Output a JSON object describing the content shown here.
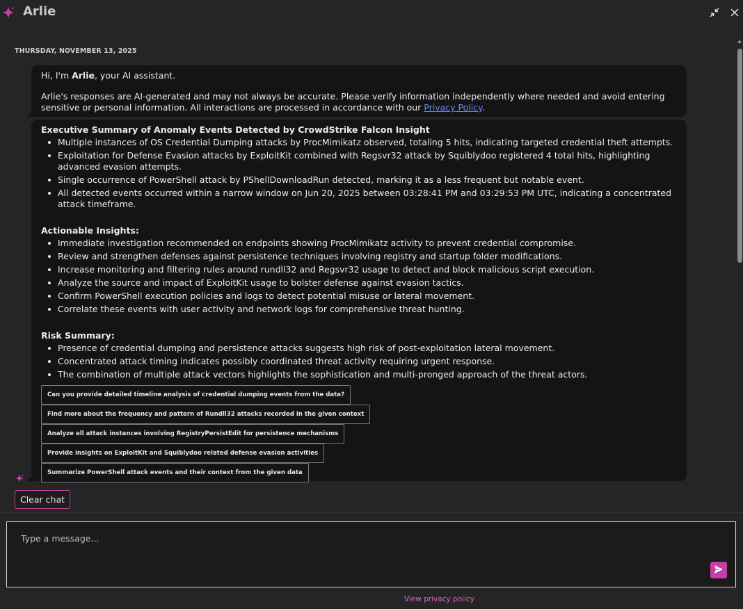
{
  "app": {
    "title": "Arlie",
    "accent_color": "#c43fa3",
    "icons": {
      "brand": "sparkle-icon",
      "collapse": "collapse-arrows-icon",
      "close": "close-icon",
      "send": "send-arrow-icon"
    }
  },
  "chat": {
    "date": "THURSDAY, NOVEMBER 13, 2025",
    "greeting": {
      "hi": "Hi, I'm ",
      "name": "Arlie",
      "rest": ", your AI assistant.",
      "disclaimer": "Arlie's responses are AI-generated and may not always be accurate. Please verify information independently where needed and avoid entering sensitive or personal information. All interactions are processed in accordance with our ",
      "privacy_link": "Privacy Policy",
      "period": "."
    },
    "answer": {
      "summary_title": "Executive Summary of Anomaly Events Detected by CrowdStrike Falcon Insight",
      "summary_items": [
        "Multiple instances of OS Credential Dumping attacks by ProcMimikatz observed, totaling 5 hits, indicating targeted credential theft attempts.",
        "Exploitation for Defense Evasion attacks by ExploitKit combined with Regsvr32 attack by Squiblydoo registered 4 total hits, highlighting advanced evasion attempts.",
        "Single occurrence of PowerShell attack by PShellDownloadRun detected, marking it as a less frequent but notable event.",
        "All detected events occurred within a narrow window on Jun 20, 2025 between 03:28:41 PM and 03:29:53 PM UTC, indicating a concentrated attack timeframe."
      ],
      "insights_title": "Actionable Insights:",
      "insights_items": [
        "Immediate investigation recommended on endpoints showing ProcMimikatz activity to prevent credential compromise.",
        "Review and strengthen defenses against persistence techniques involving registry and startup folder modifications.",
        "Increase monitoring and filtering rules around rundll32 and Regsvr32 usage to detect and block malicious script execution.",
        "Analyze the source and impact of ExploitKit usage to bolster defense against evasion tactics.",
        "Confirm PowerShell execution policies and logs to detect potential misuse or lateral movement.",
        "Correlate these events with user activity and network logs for comprehensive threat hunting."
      ],
      "risk_title": "Risk Summary:",
      "risk_items": [
        "Presence of credential dumping and persistence attacks suggests high risk of post-exploitation lateral movement.",
        "Concentrated attack timing indicates possibly coordinated threat activity requiring urgent response.",
        "The combination of multiple attack vectors highlights the sophistication and multi-pronged approach of the threat actors."
      ],
      "suggestions": [
        "Can you provide detailed timeline analysis of credential dumping events from the data?",
        "Find more about the frequency and pattern of Rundll32 attacks recorded in the given context",
        "Analyze all attack instances involving RegistryPersistEdit for persistence mechanisms",
        "Provide insights on ExploitKit and Squiblydoo related defense evasion activities",
        "Summarize PowerShell attack events and their context from the given data"
      ]
    },
    "clear_label": "Clear chat"
  },
  "composer": {
    "placeholder": "Type a message...",
    "value": ""
  },
  "footer": {
    "privacy_label": "View privacy policy"
  }
}
